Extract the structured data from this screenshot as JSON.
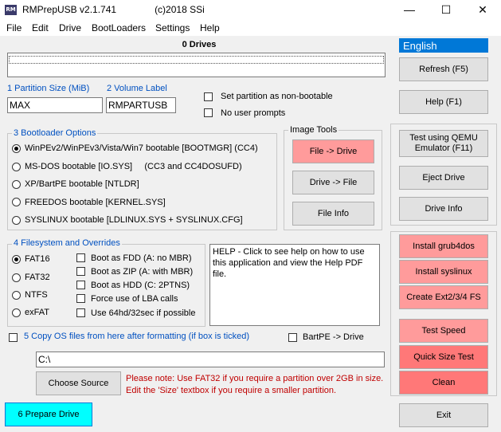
{
  "window": {
    "icon_text": "RM",
    "title": "RMPrepUSB v2.1.741",
    "copyright": "(c)2018 SSi",
    "minimize": "—",
    "maximize": "☐",
    "close": "✕"
  },
  "menu": [
    "File",
    "Edit",
    "Drive",
    "BootLoaders",
    "Settings",
    "Help"
  ],
  "drives": {
    "label": "0 Drives"
  },
  "language": {
    "selected": "English"
  },
  "right_buttons": {
    "refresh": "Refresh (F5)",
    "help": "Help (F1)",
    "test_qemu": "Test using QEMU Emulator (F11)",
    "eject": "Eject Drive",
    "drive_info": "Drive Info",
    "install_grub4dos": "Install grub4dos",
    "install_syslinux": "Install syslinux",
    "create_ext": "Create Ext2/3/4 FS",
    "test_speed": "Test Speed",
    "quick_size_test": "Quick Size Test",
    "clean": "Clean",
    "exit": "Exit"
  },
  "partition": {
    "size_label": "1 Partition Size (MiB)",
    "size_value": "MAX",
    "volume_label": "2 Volume Label",
    "volume_value": "RMPARTUSB",
    "non_bootable": "Set partition as non-bootable",
    "no_prompts": "No user prompts"
  },
  "bootloader": {
    "title": "3 Bootloader Options",
    "options": [
      "WinPEv2/WinPEv3/Vista/Win7 bootable [BOOTMGR] (CC4)",
      "MS-DOS bootable [IO.SYS]     (CC3 and CC4DOSUFD)",
      "XP/BartPE bootable [NTLDR]",
      "FREEDOS bootable [KERNEL.SYS]",
      "SYSLINUX bootable [LDLINUX.SYS + SYSLINUX.CFG]"
    ],
    "selected_index": 0
  },
  "image_tools": {
    "title": "Image Tools",
    "file_to_drive": "File -> Drive",
    "drive_to_file": "Drive -> File",
    "file_info": "File Info"
  },
  "filesystem": {
    "title": "4 Filesystem and Overrides",
    "options": [
      "FAT16",
      "FAT32",
      "NTFS",
      "exFAT"
    ],
    "selected_index": 0,
    "overrides": [
      "Boot as FDD (A: no MBR)",
      "Boot as ZIP (A: with MBR)",
      "Boot as HDD (C: 2PTNS)",
      "Force use of LBA calls",
      "Use 64hd/32sec if possible"
    ]
  },
  "help_text": "HELP - Click to see help on how to use this application and view the Help PDF file.",
  "copy_os": {
    "label": "5 Copy OS files from here after formatting (if box is ticked)",
    "bartpe": "BartPE -> Drive",
    "path": "C:\\",
    "choose_source": "Choose Source"
  },
  "note": "Please note: Use FAT32 if you require a partition over 2GB in size. Edit the 'Size' textbox if you require a smaller partition.",
  "prepare_drive": "6 Prepare Drive",
  "colors": {
    "accent_blue": "#0078d7",
    "label_blue": "#0050c0",
    "pink": "#ff9b9b",
    "red": "#ff7878",
    "cyan": "#00ffff",
    "note_red": "#c00000"
  }
}
